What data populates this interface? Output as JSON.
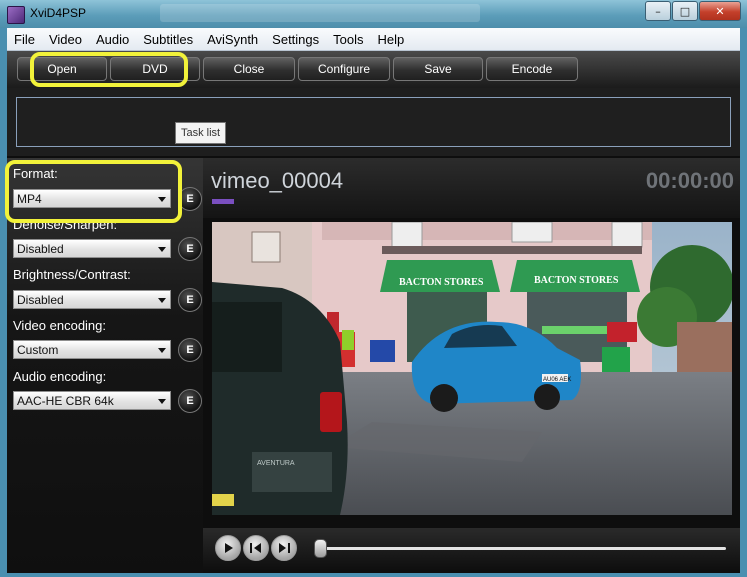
{
  "window": {
    "title": "XviD4PSP",
    "buttons": {
      "minimize": "–",
      "maximize": "□",
      "close": "✕"
    }
  },
  "menu": [
    "File",
    "Video",
    "Audio",
    "Subtitles",
    "AviSynth",
    "Settings",
    "Tools",
    "Help"
  ],
  "toolbar": {
    "open": "Open",
    "dvd": "DVD",
    "close": "Close",
    "configure": "Configure",
    "save": "Save",
    "encode": "Encode"
  },
  "tasklist": {
    "tooltip": "Task list"
  },
  "settings": {
    "format": {
      "label": "Format:",
      "value": "MP4"
    },
    "denoise": {
      "label": "Denoise/Sharpen:",
      "value": "Disabled"
    },
    "brightness": {
      "label": "Brightness/Contrast:",
      "value": "Disabled"
    },
    "video_encoding": {
      "label": "Video encoding:",
      "value": "Custom"
    },
    "audio_encoding": {
      "label": "Audio encoding:",
      "value": "AAC-HE CBR 64k"
    },
    "edit_button": "E"
  },
  "video": {
    "title": "vimeo_00004",
    "time": "00:00:00",
    "sign_left": "BACTON STORES",
    "sign_right": "BACTON STORES",
    "plate": "AU06 AEK",
    "truck_badge": "AVENTURA"
  },
  "playback": {
    "position": 0.0
  },
  "colors": {
    "highlight": "#f2f23a",
    "progress": "#7a4fc0"
  }
}
